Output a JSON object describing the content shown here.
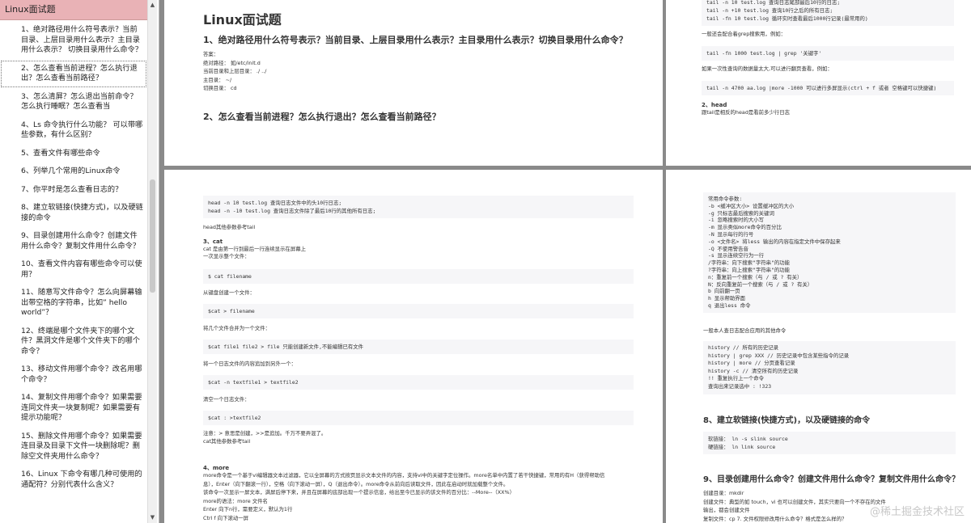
{
  "sidebar": {
    "title": "Linux面试题",
    "items": [
      {
        "label": "1、绝对路径用什么符号表示？当前目录、上层目录用什么表示？主目录用什么表示？ 切换目录用什么命令？"
      },
      {
        "label": "2、怎么查看当前进程？怎么执行退出？怎么查看当前路径？"
      },
      {
        "label": "3、怎么清屏？怎么退出当前命令？怎么执行睡眠？怎么查看当"
      },
      {
        "label": "4、Ls 命令执行什么功能？ 可以带哪些参数，有什么区别？"
      },
      {
        "label": "5、查看文件有哪些命令"
      },
      {
        "label": "6、列举几个常用的Linux命令"
      },
      {
        "label": "7、你平时是怎么查看日志的？"
      },
      {
        "label": "8、建立软链接(快捷方式)，以及硬链接的命令"
      },
      {
        "label": "9、目录创建用什么命令？创建文件用什么命令？复制文件用什么命令？"
      },
      {
        "label": "10、查看文件内容有哪些命令可以使用？"
      },
      {
        "label": "11、随意写文件命令？怎么向屏幕输出带空格的字符串，比如” hello world”？"
      },
      {
        "label": "12、终端是哪个文件夹下的哪个文件？黑洞文件是哪个文件夹下的哪个命令？"
      },
      {
        "label": "13、移动文件用哪个命令？改名用哪个命令？"
      },
      {
        "label": "14、复制文件用哪个命令？如果需要连同文件夹一块复制呢？如果需要有提示功能呢？"
      },
      {
        "label": "15、删除文件用哪个命令？如果需要连目录及目录下文件一块删除呢？删除空文件夹用什么命令？"
      },
      {
        "label": "16、Linux 下命令有哪几种可使用的通配符？分别代表什么含义？"
      }
    ],
    "scroll_up": "▲",
    "scroll_down": "▼"
  },
  "page1": {
    "title": "Linux面试题",
    "q1": "1、绝对路径用什么符号表示？当前目录、上层目录用什么表示？主目录用什么表示？切换目录用什么命令？",
    "lines": [
      "答案：",
      "绝对路径： 如/etc/init.d",
      "当前目录和上层目录： ./ ../",
      "主目录： ~/",
      "切换目录： cd"
    ],
    "q2": "2、怎么查看当前进程？怎么执行退出？怎么查看当前路径？"
  },
  "page2": {
    "code1": [
      "tail -n 10 test.log 查询日志尾部最后10行的日志;",
      "tail -n +10 test.log 查询10行之后的所有日志;",
      "tail -fn 10 test.log 循环实时查看最后1000行记录(最常用的)"
    ],
    "t1": "一般还会配合着grep搜索用，例如：",
    "code2": "tail -fn 1000 test.log | grep '关键字'",
    "t2": "如果一次性查询的数据量太大,可以进行翻页查看，例如：",
    "code3": "tail -n 4700 aa.log |more -1000 可以进行多屏显示(ctrl + f 或者 空格键可以快捷键)",
    "h": "2、head",
    "t3": "跟tail是相反的head是看前多少行日志"
  },
  "page3": {
    "code1": [
      "head -n 10 test.log 查询日志文件中的头10行日志;",
      "head -n -10 test.log 查询日志文件除了最后10行的其他所有日志;"
    ],
    "t1": "head其他参数参考tail",
    "h_cat": "3、cat",
    "t2": "cat 是由第一行到最后一行连续显示在屏幕上",
    "t3": "一次显示整个文件：",
    "c2": "$ cat filename",
    "t4": "从键盘创建一个文件：",
    "c3": "$cat > filename",
    "t5": "将几个文件合并为一个文件：",
    "c4": "$cat file1 file2 > file 只能创建新文件,不能编辑已有文件",
    "t6": "将一个日志文件的内容追加到另外一个：",
    "c5": "$cat -n textfile1 > textfile2",
    "t7": "清空一个日志文件：",
    "c6": "$cat : >textfile2",
    "t8": "注意：> 意思是创建，>>是追加。千万不要弄混了。",
    "t9": "cat其他参数参考tail",
    "h_more": "4、more",
    "more_lines": [
      "more命令是一个基于vi编辑器文本过滤器，它以全屏幕的方式按页显示文本文件的内容，支持vi中的关键字定位操作。more名单中内置了若干快捷键，常用的有H（获得帮助信",
      "息），Enter（向下翻滚一行），空格（向下滚动一屏），Q（退出命令）。more命令从前向后读取文件，因此在启动时就加载整个文件。",
      "该命令一次显示一屏文本，满屏后停下来，并且在屏幕的底部出现一个提示信息，给出至今已显示的该文件的百分比：--More--（XX%）",
      "more的语法：more 文件名",
      "Enter 向下n行，需要定义，默认为1行",
      "Ctrl f 向下滚动一屏"
    ]
  },
  "page4": {
    "params_title": "常用命令参数:",
    "params": [
      "-b <缓冲区大小> 设置缓冲区的大小",
      "-g 只标志最后搜索的关键词",
      "-i 忽略搜索时的大小写",
      "-m 显示类似more命令的百分比",
      "-N 显示每行的行号",
      "-o <文件名> 将less 输出的内容在指定文件中保存起来",
      "-Q 不使用警告音",
      "-s 显示连续空行为一行",
      "/字符串：向下搜索\"字符串\"的功能",
      "?字符串：向上搜索\"字符串\"的功能",
      "n：重复前一个搜索（与 / 或 ? 有关）",
      "N：反向重复前一个搜索（与 / 或 ? 有关）",
      "b 向前翻一页",
      "h 显示帮助界面",
      "q 退出less 命令"
    ],
    "t1": "一般本人查日志配合应用的其他命令",
    "history": [
      "history // 所有的历史记录",
      "history | grep XXX // 历史记录中包含某些指令的记录",
      "history | more // 分页查看记录",
      "history -c // 清空所有的历史记录",
      "!! 重复执行上一个命令",
      "查询出来记录选中 : !323"
    ],
    "q8": "8、建立软链接(快捷方式)，以及硬链接的命令",
    "links": [
      "软链接： ln -s slink source",
      "硬链接： ln link source"
    ],
    "q9": "9、目录创建用什么命令？创建文件用什么命令？复制文件用什么命令？",
    "ans": [
      "创建目录：mkdir",
      "创建文件：典型的如 touch，vi 也可以创建文件，其实只要向一个不存在的文件",
      "输出，都会创建文件",
      "复制文件：cp 7. 文件权限修改用什么命令？格式是怎么样的？"
    ]
  },
  "watermark": "@稀土掘金技术社区"
}
